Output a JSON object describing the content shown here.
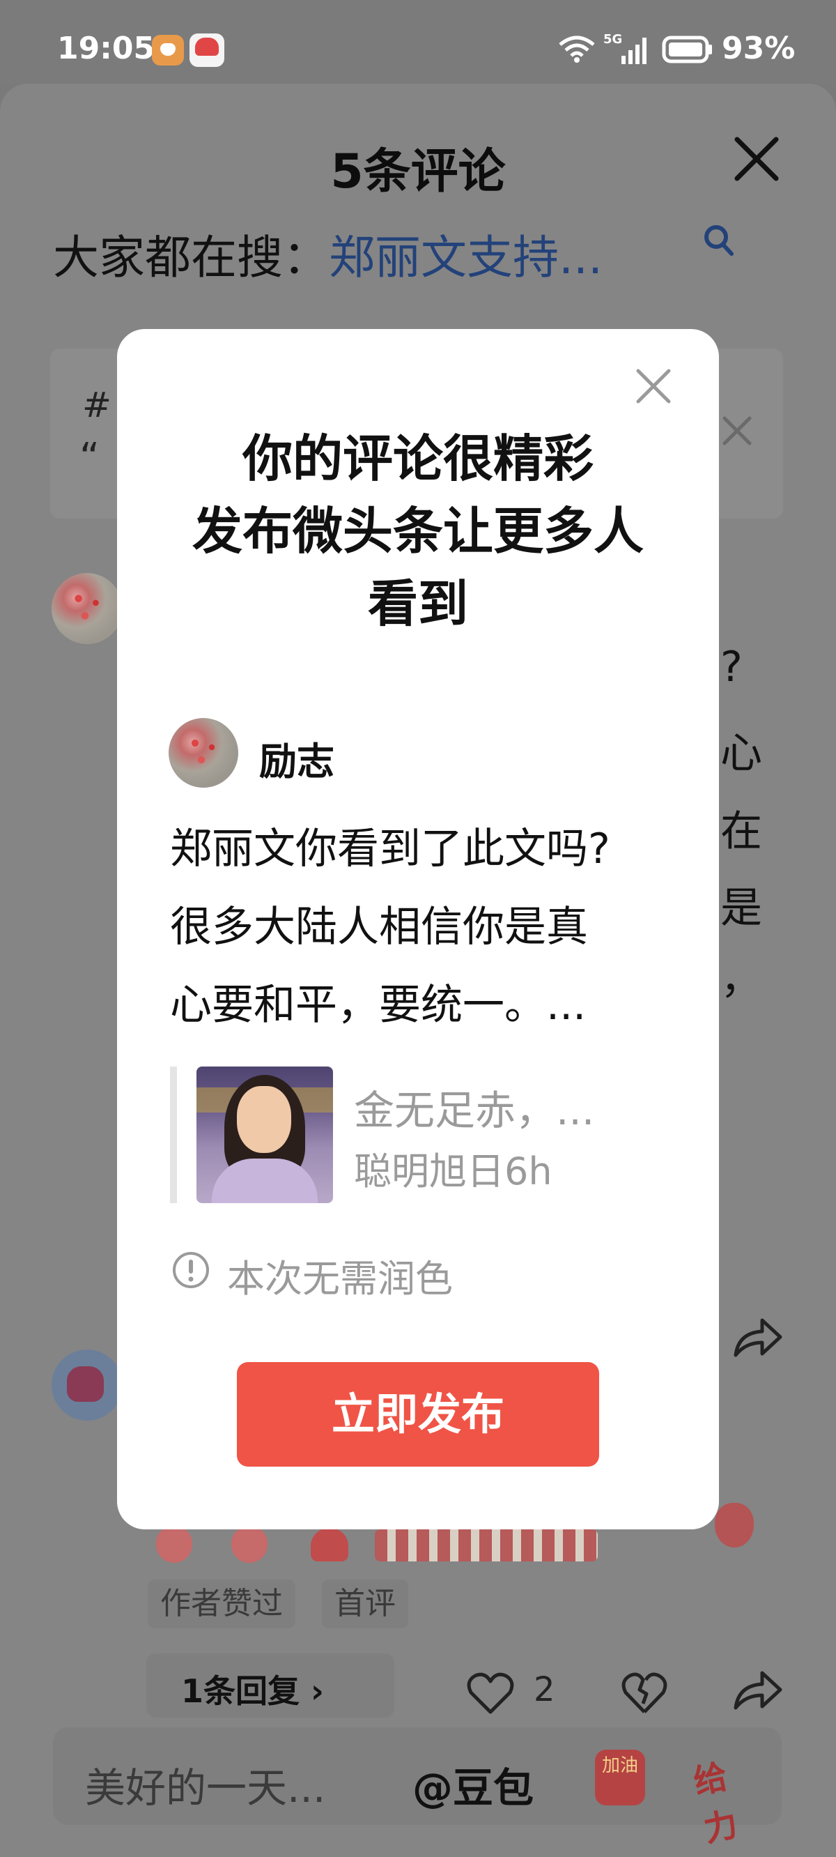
{
  "status_bar": {
    "time": "19:05",
    "network": "5G",
    "battery": "93%"
  },
  "sheet": {
    "title": "5条评论",
    "hot_search_prefix": "大家都在搜：",
    "hot_search_link": "郑丽文支持...",
    "topic_hash": "#",
    "topic_quote": "“",
    "fragments": [
      "?",
      "心",
      "在",
      "是",
      "，"
    ],
    "tags": [
      "作者赞过",
      "首评"
    ],
    "reply_label": "1条回复 ›",
    "like_count": "2",
    "input_placeholder": "美好的一天...",
    "mention_label": "@豆包",
    "badge_cheer": "加油",
    "badge_give": "给力"
  },
  "modal": {
    "title_lines": [
      "你的评论很精彩",
      "发布微头条让更多人",
      "看到"
    ],
    "author": "励志",
    "body_lines": [
      "郑丽文你看到了此文吗?",
      "很多大陆人相信你是真",
      "心要和平，要统一。..."
    ],
    "quote_title": "金无足赤，...",
    "quote_meta": "聪明旭日6h",
    "info_text": "本次无需润色",
    "publish_label": "立即发布"
  },
  "colors": {
    "accent_button": "#ef5446",
    "link_blue": "#23427a",
    "overlay_gray": "#858585"
  },
  "icons": [
    "close-icon",
    "search-icon",
    "share-icon",
    "like-icon",
    "dislike-icon",
    "info-icon",
    "wifi-icon",
    "signal-icon",
    "battery-icon"
  ]
}
